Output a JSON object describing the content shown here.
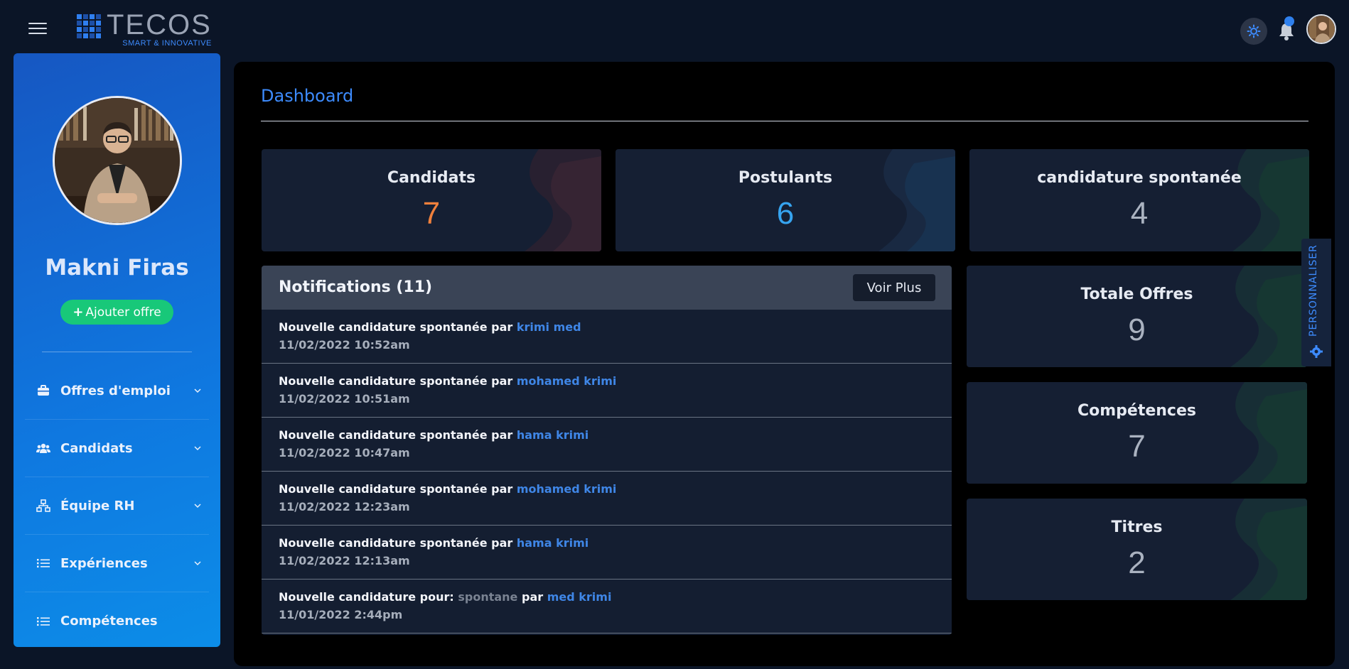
{
  "header": {
    "logo_main": "TECOS",
    "logo_sub": "SMART & INNOVATIVE"
  },
  "sidebar": {
    "user_name": "Makni Firas",
    "add_offer_label": "Ajouter offre",
    "items": [
      {
        "label": "Offres d'emploi",
        "icon": "briefcase-icon"
      },
      {
        "label": "Candidats",
        "icon": "users-icon"
      },
      {
        "label": "Équipe RH",
        "icon": "sitemap-icon"
      },
      {
        "label": "Expériences",
        "icon": "list-icon"
      },
      {
        "label": "Compétences",
        "icon": "list-icon"
      }
    ]
  },
  "main": {
    "title": "Dashboard",
    "stats": [
      {
        "label": "Candidats",
        "value": "7",
        "color": "#f0803c"
      },
      {
        "label": "Postulants",
        "value": "6",
        "color": "#36a4f0"
      },
      {
        "label": "candidature spontanée",
        "value": "4",
        "color": "#aab2c0"
      },
      {
        "label": "Totale Offres",
        "value": "9",
        "color": "#aab2c0"
      },
      {
        "label": "Compétences",
        "value": "7",
        "color": "#aab2c0"
      },
      {
        "label": "Titres",
        "value": "2",
        "color": "#aab2c0"
      }
    ],
    "notifications": {
      "title": "Notifications (11)",
      "more_label": "Voir Plus",
      "items": [
        {
          "text": "Nouvelle candidature spontanée par",
          "name": "krimi med",
          "date": "11/02/2022 10:52am"
        },
        {
          "text": "Nouvelle candidature spontanée par",
          "name": "mohamed krimi",
          "date": "11/02/2022 10:51am"
        },
        {
          "text": "Nouvelle candidature spontanée par",
          "name": "hama krimi",
          "date": "11/02/2022 10:47am"
        },
        {
          "text": "Nouvelle candidature spontanée par",
          "name": "mohamed krimi",
          "date": "11/02/2022 12:23am"
        },
        {
          "text": "Nouvelle candidature spontanée par",
          "name": "hama krimi",
          "date": "11/02/2022 12:13am"
        }
      ],
      "last_item": {
        "prefix": "Nouvelle candidature pour:",
        "offer": "spontane",
        "middle": "par",
        "name": "med krimi",
        "date": "11/01/2022 2:44pm"
      }
    }
  },
  "personaliser_label": "PERSONNALISER"
}
